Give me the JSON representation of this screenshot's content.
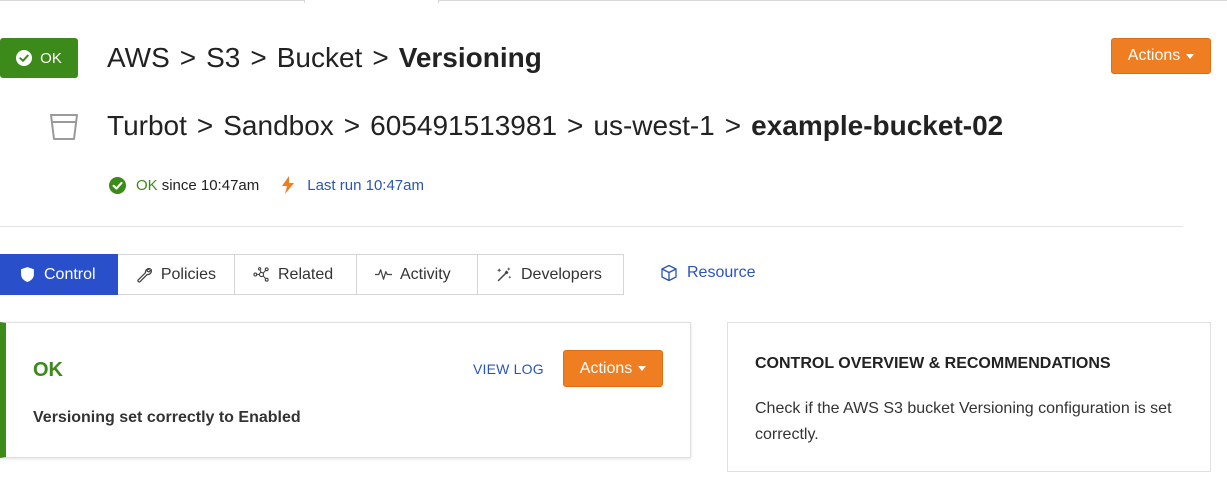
{
  "status": {
    "badge_label": "OK",
    "ok_word": "OK",
    "since_text": "since 10:47am",
    "last_run_text": "Last run 10:47am"
  },
  "title": {
    "crumbs": [
      "AWS",
      "S3",
      "Bucket"
    ],
    "current": "Versioning",
    "separator": ">"
  },
  "resource_path": {
    "crumbs": [
      "Turbot",
      "Sandbox",
      "605491513981",
      "us-west-1"
    ],
    "current": "example-bucket-02",
    "separator": ">"
  },
  "header_actions_label": "Actions",
  "tabs": [
    {
      "label": "Control",
      "icon": "shield-icon",
      "active": true
    },
    {
      "label": "Policies",
      "icon": "wrench-icon",
      "active": false
    },
    {
      "label": "Related",
      "icon": "network-icon",
      "active": false
    },
    {
      "label": "Activity",
      "icon": "pulse-icon",
      "active": false
    },
    {
      "label": "Developers",
      "icon": "magic-wand-icon",
      "active": false
    }
  ],
  "resource_link": {
    "label": "Resource",
    "icon": "cube-icon"
  },
  "control_card": {
    "state": "OK",
    "view_log_label": "VIEW LOG",
    "actions_label": "Actions",
    "reason": "Versioning set correctly to Enabled"
  },
  "overview_card": {
    "heading": "CONTROL OVERVIEW & RECOMMENDATIONS",
    "description": "Check if the AWS S3 bucket Versioning configuration is set correctly."
  },
  "colors": {
    "ok_green": "#3c8a1a",
    "accent_orange": "#ef7d22",
    "link_blue": "#2a55b5",
    "tab_active_blue": "#2a4fcb"
  }
}
